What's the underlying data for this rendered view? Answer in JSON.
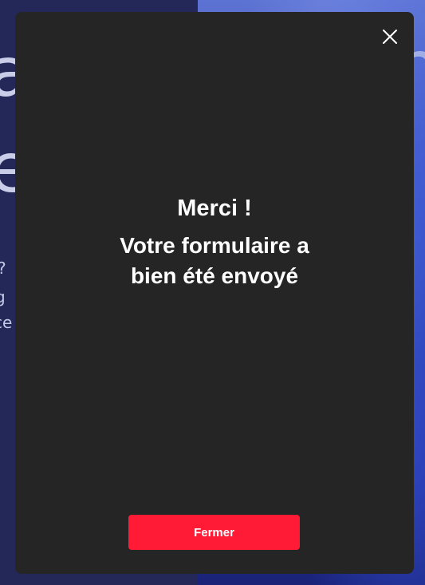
{
  "background": {
    "left_big_letters": [
      "a",
      "e"
    ],
    "left_small_text": [
      "?",
      "g",
      "ce"
    ],
    "right_big_letter": "n"
  },
  "modal": {
    "close_icon": "close-icon",
    "title": "Merci !",
    "message": "Votre formulaire a bien été envoyé",
    "close_button_label": "Fermer"
  },
  "colors": {
    "modal_bg": "#252525",
    "button_bg": "#ff1a35",
    "text": "#ffffff"
  }
}
